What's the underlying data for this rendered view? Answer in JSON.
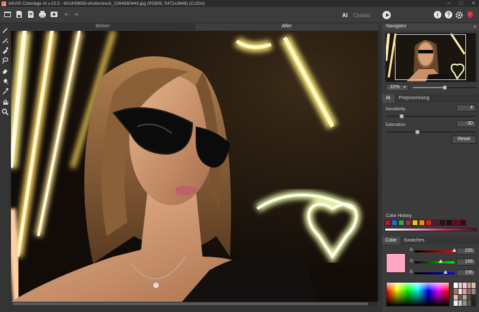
{
  "window": {
    "title": "AKVIS Coloriage AI v.15.5 - 601439659-shutterstock_2264580443.jpg (RGB/8, 5472x3648) (CUDA)",
    "controls": [
      "minimize",
      "maximize",
      "close"
    ]
  },
  "toolbar": {
    "buttons": [
      "open-icon",
      "save-icon",
      "save-as-icon",
      "print-icon",
      "share-icon",
      "undo-icon",
      "redo-icon"
    ],
    "mode_ai": "AI",
    "mode_classic": "Classic",
    "right_icons": [
      "run-icon",
      "info-icon",
      "help-icon",
      "settings-icon",
      "akvis-icon"
    ]
  },
  "tools": [
    "pencil-icon",
    "color-range-icon",
    "magic-tube-icon",
    "eyedropper-icon",
    "eraser-icon",
    "bucket-icon",
    "pipette-icon",
    "hand-icon",
    "zoom-icon"
  ],
  "view_tabs": {
    "before": "Before",
    "after": "After",
    "active": "after"
  },
  "navigator": {
    "title": "Navigator",
    "zoom": "22%",
    "zoom_slider": 0.5
  },
  "settings": {
    "tabs": [
      "AI",
      "Preprocessing"
    ],
    "active_tab": "AI",
    "sensitivity": {
      "label": "Sensitivity",
      "value": "4",
      "slider": 0.18
    },
    "saturation": {
      "label": "Saturation",
      "value": "-30",
      "slider": 0.35
    },
    "reset": "Reset"
  },
  "color_history": {
    "title": "Color History",
    "colors": [
      "#c8102e",
      "#1e6fd9",
      "#3aa84a",
      "#a0304a",
      "#f0c020",
      "#ff8c00",
      "#d82020",
      "#6a1020",
      "#3a0a14",
      "#2a0810",
      "#7a0018",
      "#4a0010"
    ]
  },
  "color_panel": {
    "tabs": [
      "Color",
      "Swatches"
    ],
    "active_tab": "Color",
    "current_color": "#ffa6c4",
    "r": {
      "label": "R",
      "value": "255"
    },
    "g": {
      "label": "G",
      "value": "166"
    },
    "b": {
      "label": "B",
      "value": "196"
    }
  },
  "swatches": [
    "#ffffff",
    "#e8d0c8",
    "#f0c8d8",
    "#c8a090",
    "#d8b8b0",
    "#b07060",
    "#f8e0e0",
    "#d0a0a8",
    "#907060",
    "#a08080",
    "#e0c0b0",
    "#706050",
    "#c0a090",
    "#584840",
    "#302820",
    "#f0f0f0",
    "#c8c8c8",
    "#909090",
    "#585858",
    "#202020"
  ]
}
